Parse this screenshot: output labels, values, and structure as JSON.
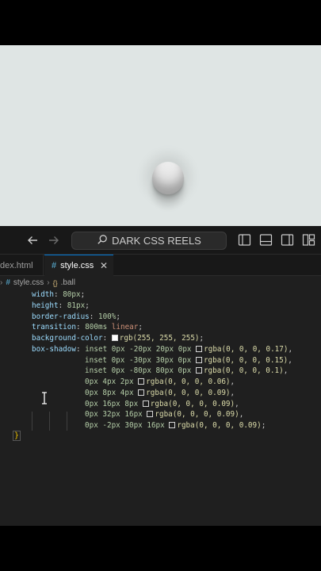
{
  "titlebar": {
    "back_icon": "arrow-left-icon",
    "forward_icon": "arrow-right-icon",
    "search_icon": "search-icon",
    "command_center_label": "DARK CSS REELS",
    "layout_icons": [
      "toggle-primary-sidebar-icon",
      "toggle-panel-icon",
      "toggle-secondary-sidebar-icon",
      "customize-layout-icon"
    ]
  },
  "tabs": [
    {
      "label": "dex.html",
      "active": false
    },
    {
      "label": "style.css",
      "active": true,
      "icon": "#",
      "close": "✕"
    }
  ],
  "breadcrumb": {
    "file": "style.css",
    "symbol": ".ball",
    "file_icon": "#"
  },
  "code": {
    "width_prop": "width",
    "width_val": "80px",
    "height_prop": "height",
    "height_val": "81px",
    "radius_prop": "border-radius",
    "radius_val": "100%",
    "transition_prop": "transition",
    "transition_num": "800ms",
    "transition_kw": "linear",
    "bg_prop": "background-color",
    "bg_val": "rgb(255, 255, 255)",
    "shadow_prop": "box-shadow",
    "shadows": [
      {
        "pre": "inset 0px -20px 20px 0px ",
        "fn": "rgba(0, 0, 0, 0.17)",
        "end": ","
      },
      {
        "pre": "inset 0px -30px 30px 0px ",
        "fn": "rgba(0, 0, 0, 0.15)",
        "end": ","
      },
      {
        "pre": "inset 0px -80px 80px 0px ",
        "fn": "rgba(0, 0, 0, 0.1)",
        "end": ","
      },
      {
        "pre": "0px 4px 2px ",
        "fn": "rgba(0, 0, 0, 0.06)",
        "end": ","
      },
      {
        "pre": "0px 8px 4px ",
        "fn": "rgba(0, 0, 0, 0.09)",
        "end": ","
      },
      {
        "pre": "0px 16px 8px ",
        "fn": "rgba(0, 0, 0, 0.09)",
        "end": ","
      },
      {
        "pre": "0px 32px 16px ",
        "fn": "rgba(0, 0, 0, 0.09)",
        "end": ","
      },
      {
        "pre": "0px -2px 30px 16px ",
        "fn": "rgba(0, 0, 0, 0.09)",
        "end": ";"
      }
    ],
    "closing_brace": "}"
  },
  "colors": {
    "preview_bg": "#dfe5e4",
    "editor_bg": "#1f1f1f",
    "accent": "#0078d4",
    "property": "#9cdcfe",
    "number": "#b5cea8",
    "keyword": "#ce9178",
    "function": "#dcdcaa"
  }
}
